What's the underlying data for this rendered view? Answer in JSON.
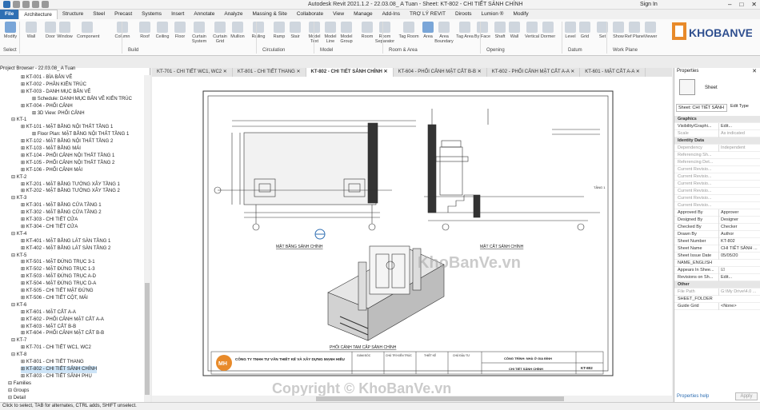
{
  "app": {
    "title": "Autodesk Revit 2021.1.2 - 22.03.08_ A Tuan - Sheet: KT-802 - CHI TIẾT SẢNH CHÍNH",
    "signin": "Sign In"
  },
  "tabs": [
    "File",
    "Architecture",
    "Structure",
    "Steel",
    "Precast",
    "Systems",
    "Insert",
    "Annotate",
    "Analyze",
    "Massing & Site",
    "Collaborate",
    "View",
    "Manage",
    "Add-Ins",
    "TRỢ LÝ REVIT",
    "Diroots",
    "Lumion ®",
    "Modify"
  ],
  "ribbon": {
    "buttons": [
      "Modify",
      "Wall",
      "Door",
      "Window",
      "Component",
      "Column",
      "Roof",
      "Ceiling",
      "Floor",
      "Curtain System",
      "Curtain Grid",
      "Mullion",
      "Railing",
      "Ramp",
      "Stair",
      "Model Text",
      "Model Line",
      "Model Group",
      "Room",
      "Room Separator",
      "Tag Room",
      "Area",
      "Area Boundary",
      "Tag Area",
      "By Face",
      "Shaft",
      "Wall",
      "Vertical",
      "Dormer",
      "Level",
      "Grid",
      "Set",
      "Show",
      "Ref Plane",
      "Viewer"
    ],
    "groups": [
      "Select",
      "Build",
      "Circulation",
      "Model",
      "Room & Area",
      "Opening",
      "Datum",
      "Work Plane"
    ]
  },
  "browser": {
    "title": "Project Browser - 22.03.08_ A Tuan",
    "items": [
      "KT-001 - BÌA BẢN VẼ",
      "KT-002 - PHÂN KIẾN TRÚC",
      "KT-003 - DANH MỤC BẢN VẼ",
      "Schedule: DANH MỤC BẢN VẼ KIẾN TRÚC",
      "KT-004 - PHỐI CẢNH",
      "3D View: PHỐI CẢNH",
      "KT-1",
      "KT-101 - MẶT BẰNG NỘI THẤT TẦNG 1",
      "Floor Plan: MẶT BẰNG NỘI THẤT TẦNG 1",
      "KT-102 - MẶT BẰNG NỘI THẤT TẦNG 2",
      "KT-103 - MẶT BẰNG MÁI",
      "KT-104 - PHỐI CẢNH NỘI THẤT TẦNG 1",
      "KT-105 - PHỐI CẢNH NỘI THẤT TẦNG 2",
      "KT-106 - PHỐI CẢNH MÁI",
      "KT-2",
      "KT-201 - MẶT BẰNG TƯỜNG XÂY TẦNG 1",
      "KT-202 - MẶT BẰNG TƯỜNG XÂY TẦNG 2",
      "KT-3",
      "KT-301 - MẶT BẰNG CỬA TẦNG 1",
      "KT-302 - MẶT BẰNG CỬA TẦNG 2",
      "KT-303 - CHI TIẾT CỬA",
      "KT-304 - CHI TIẾT CỬA",
      "KT-4",
      "KT-401 - MẶT BẰNG LÁT SÀN TẦNG 1",
      "KT-402 - MẶT BẰNG LÁT SÀN TẦNG 2",
      "KT-5",
      "KT-501 - MẶT ĐỨNG TRỤC 3-1",
      "KT-502 - MẶT ĐỨNG TRỤC 1-3",
      "KT-503 - MẶT ĐỨNG TRỤC A-D",
      "KT-504 - MẶT ĐỨNG TRỤC D-A",
      "KT-505 - CHI TIẾT MẶT ĐỨNG",
      "KT-506 - CHI TIẾT CỘT, MÁI",
      "KT-6",
      "KT-601 - MẶT CẮT A-A",
      "KT-602 - PHỐI CẢNH MẶT CẮT A-A",
      "KT-603 - MẶT CẮT B-B",
      "KT-604 - PHỐI CẢNH MẶT CẮT B-B",
      "KT-7",
      "KT-701 - CHI TIẾT WC1, WC2",
      "KT-8",
      "KT-801 - CHI TIẾT THANG",
      "KT-802 - CHI TIẾT SẢNH CHÍNH",
      "KT-803 - CHI TIẾT SẢNH PHỤ",
      "Families",
      "Groups",
      "Detail"
    ]
  },
  "view_tabs": [
    "KT-701 - CHI TIẾT WC1, WC2",
    "KT-801 - CHI TIẾT THANG",
    "KT-802 - CHI TIẾT SẢNH CHÍNH",
    "KT-604 - PHỐI CẢNH MẶT CẮT B-B",
    "KT-602 - PHỐI CẢNH MẶT CẮT A-A",
    "KT-601 - MẶT CẮT A-A"
  ],
  "drawing": {
    "label_plan": "MẶT BẰNG SẢNH CHÍNH",
    "label_section": "MẶT CẮT SẢNH CHÍNH",
    "label_3d": "PHỐI CẢNH TAM CẤP SẢNH CHÍNH",
    "company": "CÔNG TY TNHH TƯ VẤN THIẾT KẾ VÀ XÂY DỰNG MẠNH HIẾU",
    "company_short": "MH",
    "project_label": "CÔNG TRÌNH: NHÀ Ở GIA ĐÌNH",
    "sheet_title": "CHI TIẾT SẢNH CHÍNH",
    "sheet_number": "KT-802",
    "col_headers": [
      "GIÁM ĐỐC",
      "CHỦ TRÌ KIẾN TRÚC",
      "THIẾT KẾ",
      "CHỦ ĐẦU TƯ"
    ],
    "level_1": "TẦNG 1"
  },
  "properties": {
    "title": "Properties",
    "type": "Sheet",
    "selector": "Sheet: CHI TIẾT SẢNH",
    "edit_type": "Edit Type",
    "rows": [
      {
        "k": "Graphics",
        "v": "",
        "hdr": true
      },
      {
        "k": "Visibility/Graphi...",
        "v": "Edit..."
      },
      {
        "k": "Scale",
        "v": "As indicated",
        "grey": true
      },
      {
        "k": "Identity Data",
        "v": "",
        "hdr": true
      },
      {
        "k": "Dependency",
        "v": "Independent",
        "grey": true
      },
      {
        "k": "Referencing Sh...",
        "v": "",
        "grey": true
      },
      {
        "k": "Referencing Det...",
        "v": "",
        "grey": true
      },
      {
        "k": "Current Revisio...",
        "v": "",
        "grey": true
      },
      {
        "k": "Current Revisio...",
        "v": "",
        "grey": true
      },
      {
        "k": "Current Revisio...",
        "v": "",
        "grey": true
      },
      {
        "k": "Current Revisio...",
        "v": "",
        "grey": true
      },
      {
        "k": "Current Revisio...",
        "v": "",
        "grey": true
      },
      {
        "k": "Current Revisio...",
        "v": "",
        "grey": true
      },
      {
        "k": "Approved By",
        "v": "Approver"
      },
      {
        "k": "Designed By",
        "v": "Designer"
      },
      {
        "k": "Checked By",
        "v": "Checker"
      },
      {
        "k": "Drawn By",
        "v": "Author"
      },
      {
        "k": "Sheet Number",
        "v": "KT-802"
      },
      {
        "k": "Sheet Name",
        "v": "CHI TIẾT SẢNH ..."
      },
      {
        "k": "Sheet Issue Date",
        "v": "05/05/20"
      },
      {
        "k": "NAME_ENGLISH",
        "v": ""
      },
      {
        "k": "Appears In Shee...",
        "v": "☑"
      },
      {
        "k": "Revisions on Sh...",
        "v": "Edit..."
      },
      {
        "k": "Other",
        "v": "",
        "hdr": true
      },
      {
        "k": "File Path",
        "v": "G:\\My Drive\\4.0 ...",
        "grey": true
      },
      {
        "k": "SHEET_FOLDER",
        "v": ""
      },
      {
        "k": "Guide Grid",
        "v": "<None>"
      }
    ],
    "help": "Properties help",
    "apply": "Apply"
  },
  "status": "Click to select, TAB for alternates, CTRL adds, SHIFT unselect.",
  "watermark": {
    "logo": "KHOBANVE",
    "mid": "KhoBanVe.vn",
    "bottom": "Copyright © KhoBanVe.vn"
  }
}
